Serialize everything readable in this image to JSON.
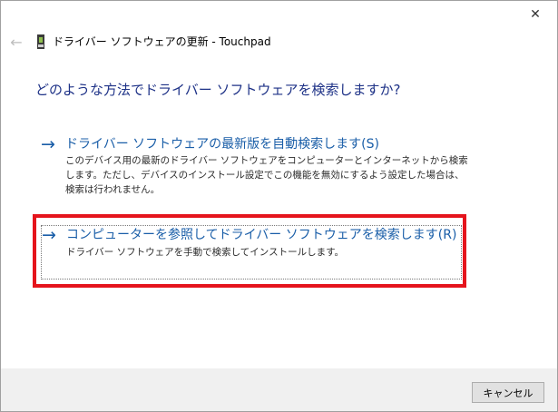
{
  "window": {
    "title": "ドライバー ソフトウェアの更新 - Touchpad",
    "close_icon": "close-icon",
    "back_icon": "back-arrow-icon",
    "device_icon": "touchpad-device-icon"
  },
  "question": "どのような方法でドライバー ソフトウェアを検索しますか?",
  "options": [
    {
      "arrow": "→",
      "title": "ドライバー ソフトウェアの最新版を自動検索します(S)",
      "description": "このデバイス用の最新のドライバー ソフトウェアをコンピューターとインターネットから検索します。ただし、デバイスのインストール設定でこの機能を無効にするよう設定した場合は、検索は行われません。"
    },
    {
      "arrow": "→",
      "title": "コンピューターを参照してドライバー ソフトウェアを検索します(R)",
      "description": "ドライバー ソフトウェアを手動で検索してインストールします。"
    }
  ],
  "footer": {
    "cancel_label": "キャンセル"
  },
  "colors": {
    "link_blue": "#1a5ea8",
    "heading_blue": "#1e3287",
    "highlight_red": "#e5141c"
  }
}
